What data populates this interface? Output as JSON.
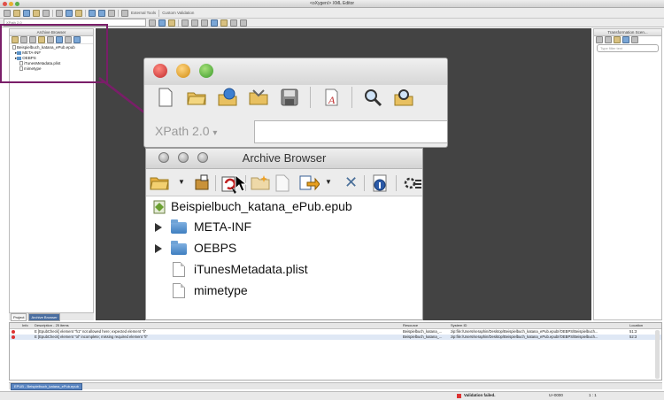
{
  "app": {
    "window_title": "<oXygen/> XML Editor",
    "toolbar": {
      "external_tools": "External Tools",
      "custom_validation": "Custom Validation",
      "xpath_mini": "XPath 2.0"
    }
  },
  "left_panel": {
    "title": "Archive Browser",
    "tree": [
      {
        "label": "Beispielbuch_katana_ePub.epub",
        "kind": "archive"
      },
      {
        "label": "META-INF",
        "kind": "folder"
      },
      {
        "label": "OEBPS",
        "kind": "folder"
      },
      {
        "label": "iTunesMetadata.plist",
        "kind": "file"
      },
      {
        "label": "mimetype",
        "kind": "file"
      }
    ],
    "tabs": {
      "project": "Project",
      "archive": "Archive Browser"
    }
  },
  "right_panel": {
    "title": "Transformation Scen...",
    "filter_placeholder": "Type filter text"
  },
  "zoom_window": {
    "xpath_label": "XPath 2.0",
    "xpath_chevron": "▾"
  },
  "archive_browser": {
    "title": "Archive Browser",
    "tree": [
      {
        "label": "Beispielbuch_katana_ePub.epub",
        "kind": "archive"
      },
      {
        "label": "META-INF",
        "kind": "folder"
      },
      {
        "label": "OEBPS",
        "kind": "folder"
      },
      {
        "label": "iTunesMetadata.plist",
        "kind": "file"
      },
      {
        "label": "mimetype",
        "kind": "file"
      }
    ]
  },
  "results": {
    "columns": {
      "info": "Info",
      "description": "Description - 25 items",
      "resource": "Resource",
      "system_id": "System ID",
      "location": "Location"
    },
    "rows": [
      {
        "severity": "E",
        "description": "E [EpubCheck] element \"h1\" not allowed here; expected element \"li\"",
        "resource": "Beispielbuch_katana_...",
        "system_id": "zip:file:/Users/seraphin/Desktop/Beispielbuch_katana_ePub.epub!/OEBPS/Beispielbuch...",
        "location": "51:3"
      },
      {
        "severity": "E",
        "description": "E [EpubCheck] element \"ol\" incomplete; missing required element \"li\"",
        "resource": "Beispielbuch_katana_...",
        "system_id": "zip:file:/Users/seraphin/Desktop/Beispielbuch_katana_ePub.epub!/OEBPS/Beispielbuch...",
        "location": "52:3"
      }
    ],
    "tab": "EPUB - Beispielbuch_katana_ePub.epub"
  },
  "status_bar": {
    "message": "Validation failed.",
    "encoding": "U+0000",
    "position": "1 : 1"
  },
  "colors": {
    "highlight": "#7a1e69",
    "editor_bg": "#434343",
    "error": "#dd3333"
  }
}
